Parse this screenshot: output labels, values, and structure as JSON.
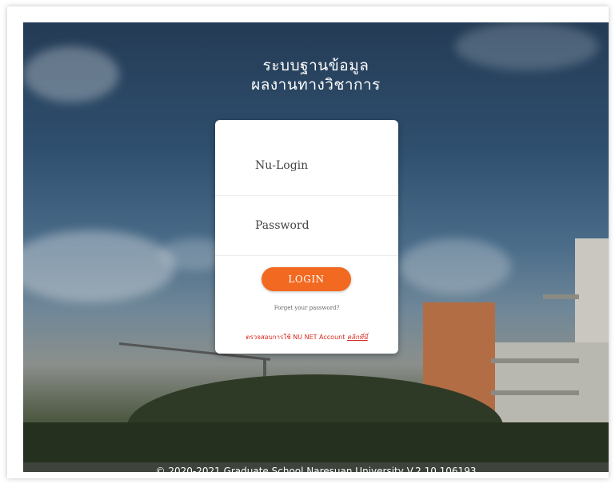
{
  "title": {
    "line1": "ระบบฐานข้อมูล",
    "line2": "ผลงานทางวิชาการ"
  },
  "login_form": {
    "username_placeholder": "Nu-Login",
    "password_placeholder": "Password",
    "login_label": "LOGIN",
    "forgot_label": "Forget your password?",
    "verify_text": "ตรวจสอบการใช้ NU NET Account",
    "verify_link": "คลิกที่นี่"
  },
  "footer": {
    "text": "© 2020-2021 Graduate School Naresuan University V.2.10.106193"
  },
  "colors": {
    "accent": "#f26a21",
    "link_red": "#d9281d"
  }
}
